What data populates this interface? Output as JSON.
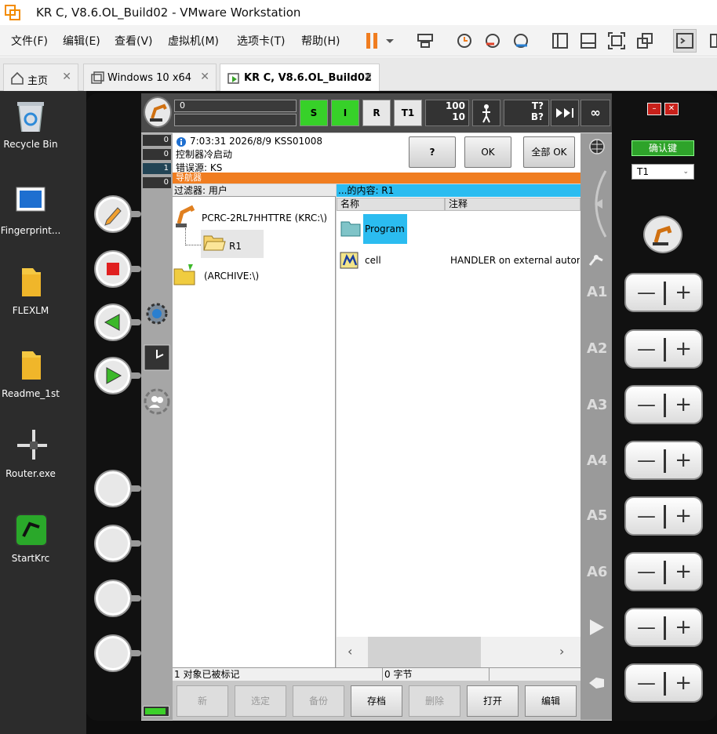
{
  "window": {
    "title": "KR C, V8.6.OL_Build02 - VMware Workstation"
  },
  "menu": [
    "文件(F)",
    "编辑(E)",
    "查看(V)",
    "虚拟机(M)",
    "选项卡(T)",
    "帮助(H)"
  ],
  "tabs": [
    {
      "label": "主页"
    },
    {
      "label": "Windows 10 x64"
    },
    {
      "label": "KR C, V8.6.OL_Build02"
    }
  ],
  "desktop": [
    {
      "label": "Recycle Bin",
      "icon": "recycle-bin-icon"
    },
    {
      "label": "Fingerprint...",
      "icon": "app-icon"
    },
    {
      "label": "FLEXLM",
      "icon": "folder-icon"
    },
    {
      "label": "Readme_1st",
      "icon": "folder-icon"
    },
    {
      "label": "Router.exe",
      "icon": "router-icon"
    },
    {
      "label": "StartKrc",
      "icon": "startkrc-icon"
    }
  ],
  "status": {
    "prog_value": "0",
    "s": "S",
    "i": "I",
    "r": "R",
    "mode": "T1",
    "override_prog": "100",
    "override_jog": "10",
    "tq_top": "T?",
    "tq_bottom": "B?",
    "infinity": "∞"
  },
  "msgcounts": [
    "0",
    "0",
    "1",
    "0"
  ],
  "message": {
    "time": "7:03:31 2026/8/9 KSS01008",
    "text": "控制器冷启动",
    "source": "错误源: KS",
    "help": "?",
    "ok": "OK",
    "all_ok": "全部 OK"
  },
  "navigator": {
    "title": "导航器",
    "filter": "过滤器: 用户",
    "content_title": "...的内容: R1",
    "tree": [
      {
        "label": "PCRC-2RL7HHTTRE (KRC:\\)"
      },
      {
        "label": "R1"
      },
      {
        "label": "(ARCHIVE:\\)"
      }
    ],
    "columns": [
      "名称",
      "注释"
    ],
    "rows": [
      {
        "name": "Program",
        "comment": ""
      },
      {
        "name": "cell",
        "comment": "HANDLER on external automat"
      }
    ],
    "status_left": "1 对象已被标记",
    "status_right": "0 字节"
  },
  "softkeys": [
    "新",
    "选定",
    "备份",
    "存档",
    "删除",
    "打开",
    "编辑"
  ],
  "right": {
    "confirm": "确认键",
    "mode_select": "T1",
    "axes": [
      "A1",
      "A2",
      "A3",
      "A4",
      "A5",
      "A6"
    ]
  },
  "colors": {
    "accent_orange": "#f07d20",
    "content_blue": "#2bbcf0",
    "status_green": "#37d129"
  }
}
